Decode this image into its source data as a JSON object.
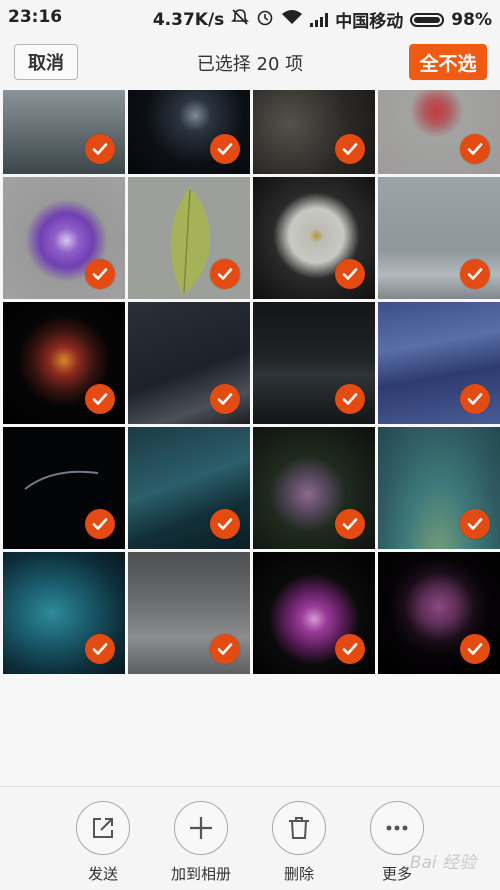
{
  "status_bar": {
    "time": "23:16",
    "speed": "4.37K/s",
    "carrier": "中国移动",
    "battery": "98%"
  },
  "header": {
    "cancel_label": "取消",
    "title": "已选择 20 项",
    "deselect_label": "全不选"
  },
  "grid": {
    "selected_count": 20,
    "tiles": [
      {
        "name": "foggy-water",
        "selected": true
      },
      {
        "name": "spiral-galaxy",
        "selected": true
      },
      {
        "name": "moon-surface",
        "selected": true
      },
      {
        "name": "red-flower",
        "selected": true
      },
      {
        "name": "purple-dahlia",
        "selected": true
      },
      {
        "name": "green-leaf",
        "selected": true
      },
      {
        "name": "white-dahlia",
        "selected": true
      },
      {
        "name": "snowy-mountain",
        "selected": true
      },
      {
        "name": "red-firework-flower",
        "selected": true
      },
      {
        "name": "milky-way-mountain",
        "selected": true
      },
      {
        "name": "dark-dunes",
        "selected": true
      },
      {
        "name": "blue-waves",
        "selected": true
      },
      {
        "name": "planet-horizon",
        "selected": true
      },
      {
        "name": "teal-wave",
        "selected": true
      },
      {
        "name": "flower-bouquet",
        "selected": true
      },
      {
        "name": "green-petals",
        "selected": true
      },
      {
        "name": "blue-nebula",
        "selected": true
      },
      {
        "name": "snowy-forest",
        "selected": true
      },
      {
        "name": "purple-dahlia-dark",
        "selected": true
      },
      {
        "name": "purple-ball-flower",
        "selected": true
      }
    ]
  },
  "actions": {
    "send_label": "发送",
    "add_album_label": "加到相册",
    "delete_label": "删除",
    "more_label": "更多"
  },
  "watermark": "Bai 经验",
  "colors": {
    "accent": "#f05b14",
    "check": "#e34b12"
  }
}
